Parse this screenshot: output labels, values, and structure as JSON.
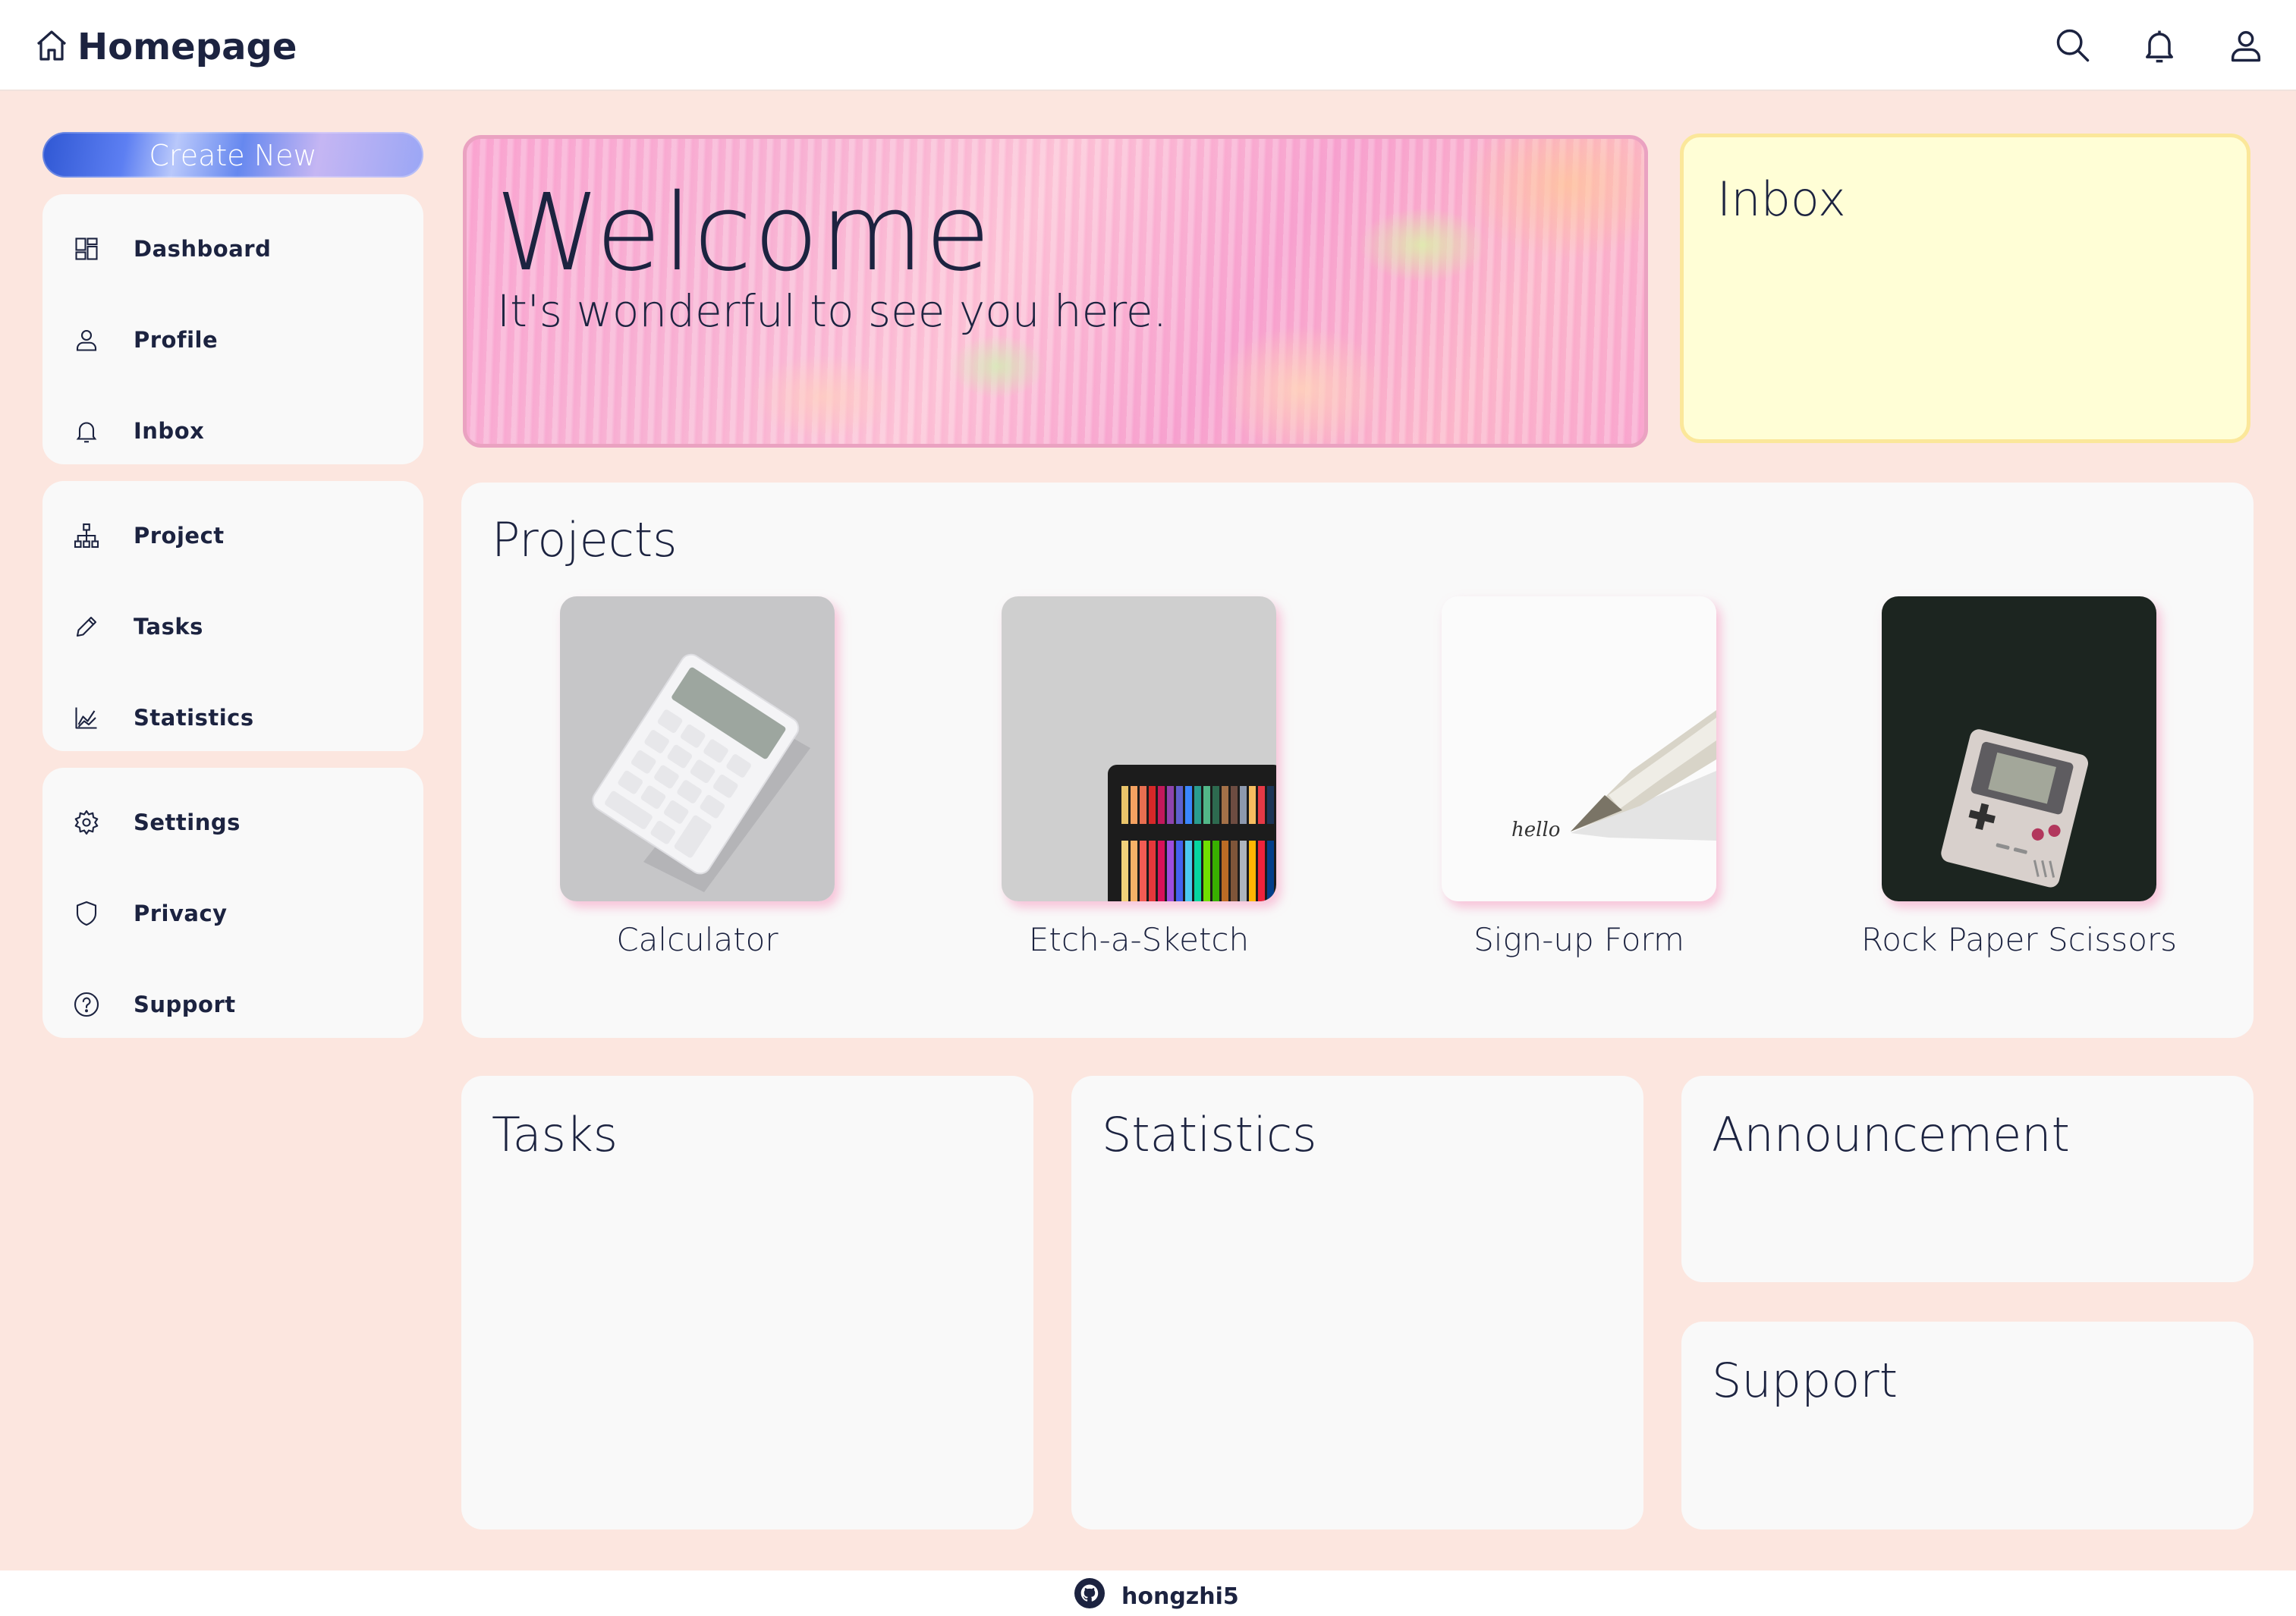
{
  "header": {
    "title": "Homepage",
    "icons": [
      "home-icon",
      "search-icon",
      "bell-icon",
      "user-icon"
    ]
  },
  "sidebar": {
    "create_label": "Create New",
    "groups": [
      {
        "items": [
          {
            "label": "Dashboard",
            "icon": "dashboard-icon"
          },
          {
            "label": "Profile",
            "icon": "user-icon"
          },
          {
            "label": "Inbox",
            "icon": "bell-icon"
          }
        ]
      },
      {
        "items": [
          {
            "label": "Project",
            "icon": "hierarchy-icon"
          },
          {
            "label": "Tasks",
            "icon": "pencil-icon"
          },
          {
            "label": "Statistics",
            "icon": "chart-icon"
          }
        ]
      },
      {
        "items": [
          {
            "label": "Settings",
            "icon": "gear-icon"
          },
          {
            "label": "Privacy",
            "icon": "shield-icon"
          },
          {
            "label": "Support",
            "icon": "help-icon"
          }
        ]
      }
    ]
  },
  "welcome": {
    "title": "Welcome",
    "subtitle": "It's wonderful to see you here."
  },
  "inbox": {
    "title": "Inbox"
  },
  "projects": {
    "title": "Projects",
    "items": [
      {
        "label": "Calculator",
        "image": "calculator-image"
      },
      {
        "label": "Etch-a-Sketch",
        "image": "colored-pencils-image"
      },
      {
        "label": "Sign-up Form",
        "image": "fountain-pen-image",
        "image_text": "hello"
      },
      {
        "label": "Rock Paper Scissors",
        "image": "gameboy-image"
      }
    ]
  },
  "cards": {
    "tasks": "Tasks",
    "statistics": "Statistics",
    "announcement": "Announcement",
    "support": "Support"
  },
  "footer": {
    "username": "hongzhi5",
    "icon": "github-icon"
  },
  "colors": {
    "background": "#fce6df",
    "text": "#1c2340",
    "card": "#f9f9f9",
    "inbox_bg": "#fffed6",
    "inbox_border": "#fbe79a",
    "welcome_border": "#eaa2c1"
  }
}
